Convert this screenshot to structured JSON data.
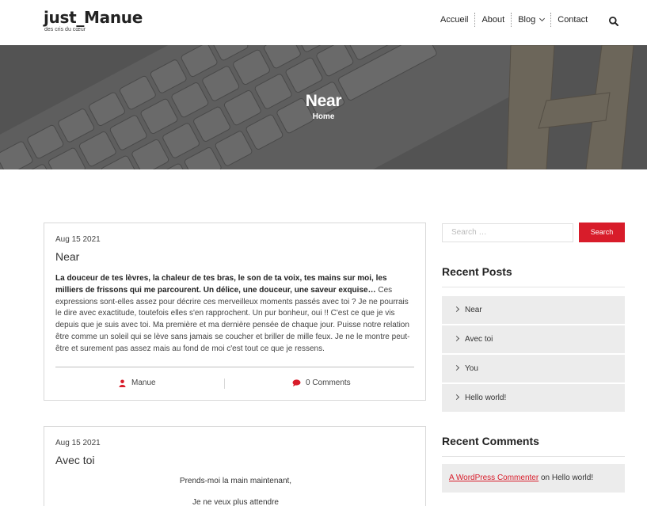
{
  "site": {
    "title": "just_Manue",
    "tagline": "des cris du cœur"
  },
  "nav": {
    "items": [
      "Accueil",
      "About",
      "Blog",
      "Contact"
    ]
  },
  "hero": {
    "title": "Near",
    "breadcrumb": "Home"
  },
  "posts": [
    {
      "date": "Aug 15 2021",
      "title": "Near",
      "excerpt_bold": "La douceur de tes lèvres, la chaleur de tes bras, le son de ta voix, tes mains sur moi, les milliers de frissons qui me parcourent. Un délice, une douceur, une saveur exquise…",
      "excerpt": " Ces expressions sont-elles assez pour décrire ces merveilleux moments passés avec toi ? Je ne pourrais le dire avec exactitude, toutefois elles s'en rapprochent. Un pur bonheur, oui !! C'est ce que je vis depuis que je suis avec toi. Ma première et ma dernière pensée de chaque jour. Puisse notre relation être comme un soleil qui se lève sans jamais se coucher et briller de mille feux. Je ne le montre peut-être et surement pas assez mais au fond de moi c'est tout ce que je ressens.",
      "author": "Manue",
      "comments": "0 Comments"
    },
    {
      "date": "Aug 15 2021",
      "title": "Avec toi",
      "line1": "Prends-moi la main maintenant,",
      "line2": "Je ne veux plus attendre"
    }
  ],
  "sidebar": {
    "search_placeholder": "Search …",
    "search_button": "Search",
    "recent_posts_title": "Recent Posts",
    "recent_posts": [
      "Near",
      "Avec toi",
      "You",
      "Hello world!"
    ],
    "recent_comments_title": "Recent Comments",
    "recent_comment": {
      "author": "A WordPress Commenter",
      "on": "on",
      "post": "Hello world!"
    }
  },
  "colors": {
    "accent": "#d81c2a",
    "hero_overlay": "#5a5a5a",
    "widget_bg": "#ececec"
  },
  "icons": [
    "search-icon",
    "chevron-down-icon",
    "user-icon",
    "comment-icon",
    "chevron-right-icon"
  ]
}
